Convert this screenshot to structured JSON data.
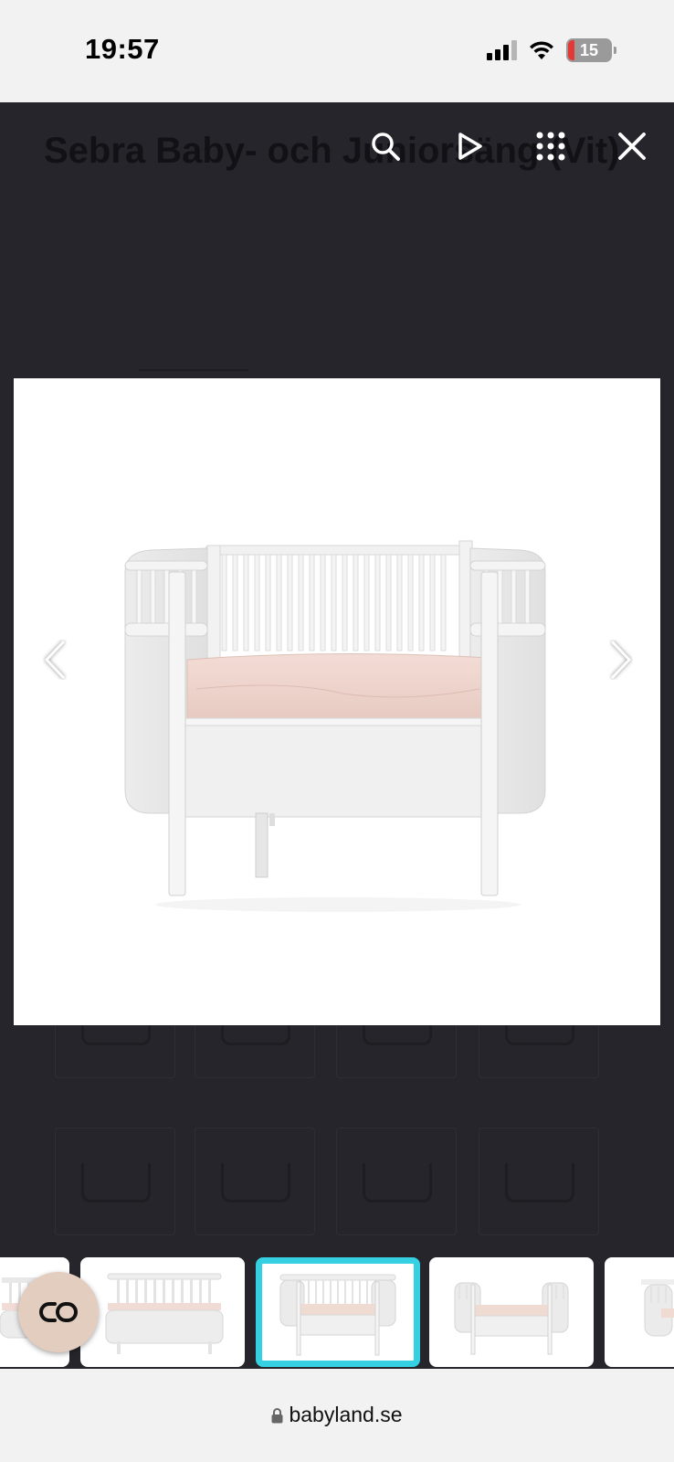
{
  "status_bar": {
    "time": "19:57",
    "battery": "15",
    "icons": [
      "cellular-signal-icon",
      "wifi-icon",
      "battery-icon"
    ]
  },
  "page": {
    "title": "Sebra Baby- och Juniorsäng (Vit)"
  },
  "viewer": {
    "toolbar": [
      "search-icon",
      "play-icon",
      "grid-icon",
      "close-icon"
    ],
    "main_image": "white-baby-bed-with-pink-mattress",
    "prev_icon": "chevron-left-icon",
    "next_icon": "chevron-right-icon",
    "thumbnails": [
      {
        "image": "bed-partial",
        "active": false
      },
      {
        "image": "bed-full-length",
        "active": false
      },
      {
        "image": "bed-front-pink-mattress",
        "active": true
      },
      {
        "image": "bed-junior-mode",
        "active": false
      },
      {
        "image": "bed-partial-right",
        "active": false
      }
    ]
  },
  "cart_fab": {
    "icon": "cart-link-icon"
  },
  "url_bar": {
    "domain": "babyland.se",
    "lock_icon": "lock-icon"
  },
  "colors": {
    "overlay": "#25252b",
    "active_thumb_border": "#35d0e2",
    "fab_background": "#e3cdbf",
    "battery_low": "#e53935"
  }
}
